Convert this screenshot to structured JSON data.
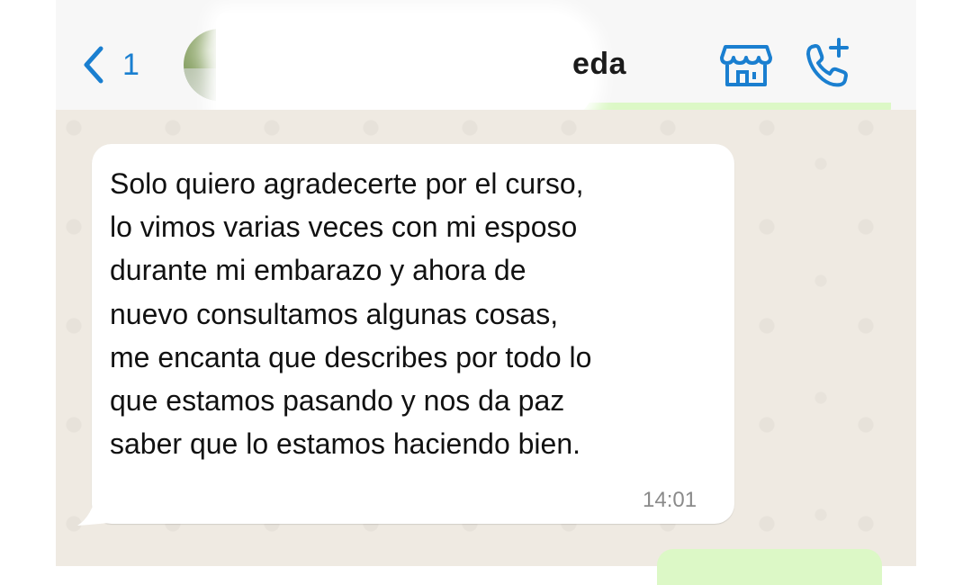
{
  "header": {
    "back_count": "1",
    "contact_name": "eda",
    "colors": {
      "accent": "#1a7fd0",
      "header_bg": "#f7f7f7"
    }
  },
  "message": {
    "text": "Solo quiero agradecerte por el curso,\nlo vimos varias veces con mi esposo\ndurante mi embarazo y ahora de\nnuevo consultamos algunas cosas,\nme encanta que describes por todo lo\nque estamos pasando y nos da paz\nsaber que lo estamos haciendo bien.",
    "time": "14:01"
  },
  "icons": {
    "back": "chevron-left-icon",
    "store": "store-icon",
    "call": "phone-plus-icon"
  },
  "colors": {
    "chat_bg": "#efeae2",
    "incoming_bubble": "#ffffff",
    "outgoing_bubble": "#dcf8c6"
  }
}
